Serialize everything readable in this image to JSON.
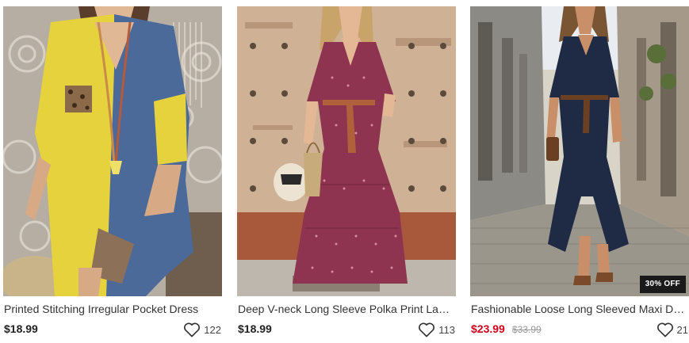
{
  "products": [
    {
      "title": "Printed Stitching Irregular Pocket Dress",
      "price": "$18.99",
      "favorites": "122",
      "icon": "heart-outline-icon"
    },
    {
      "title": "Deep V-neck Long Sleeve Polka Print Layer...",
      "price": "$18.99",
      "favorites": "113",
      "icon": "heart-outline-icon"
    },
    {
      "title": "Fashionable Loose Long Sleeved Maxi Dress",
      "price": "$23.99",
      "old_price": "$33.99",
      "discount_badge": "30% OFF",
      "favorites": "21",
      "icon": "heart-outline-icon"
    }
  ],
  "colors": {
    "sale_price": "#d0021b",
    "regular_price": "#222222",
    "badge_bg": "#1a1a1a"
  }
}
